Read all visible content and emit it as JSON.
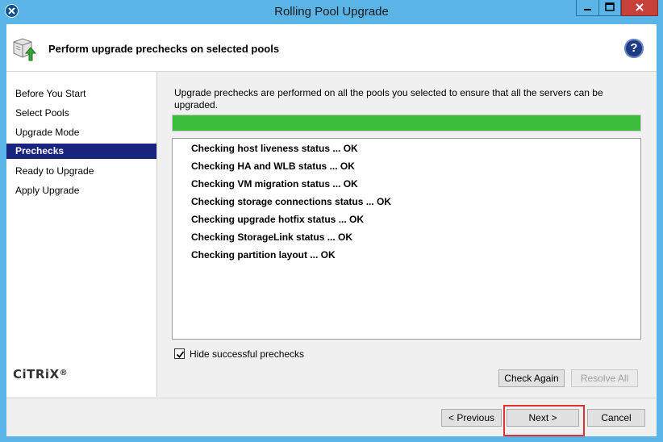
{
  "window": {
    "title": "Rolling Pool Upgrade"
  },
  "header": {
    "title": "Perform upgrade prechecks on selected pools",
    "help_label": "?"
  },
  "nav": {
    "items": [
      {
        "label": "Before You Start",
        "selected": false
      },
      {
        "label": "Select Pools",
        "selected": false
      },
      {
        "label": "Upgrade Mode",
        "selected": false
      },
      {
        "label": "Prechecks",
        "selected": true
      },
      {
        "label": "Ready to Upgrade",
        "selected": false
      },
      {
        "label": "Apply Upgrade",
        "selected": false
      }
    ],
    "logo_text": "CiTRiX",
    "logo_mark": "®"
  },
  "prechecks": {
    "description": "Upgrade prechecks are performed on all the pools you selected to ensure that all the servers can be upgraded.",
    "progress_value": 1.0,
    "progress_color": "#3cbd3c",
    "results": [
      "Checking host liveness status ... OK",
      "Checking HA and WLB status ... OK",
      "Checking VM migration status ... OK",
      "Checking storage connections status ... OK",
      "Checking upgrade hotfix status ... OK",
      "Checking StorageLink status ... OK",
      "Checking partition layout ... OK"
    ],
    "hide_successful_label": "Hide successful prechecks",
    "hide_successful_checked": true,
    "check_again_label": "Check Again",
    "resolve_all_label": "Resolve All"
  },
  "footer": {
    "previous_label": "< Previous",
    "next_label": "Next >",
    "cancel_label": "Cancel",
    "highlight_color": "#e0312e"
  }
}
